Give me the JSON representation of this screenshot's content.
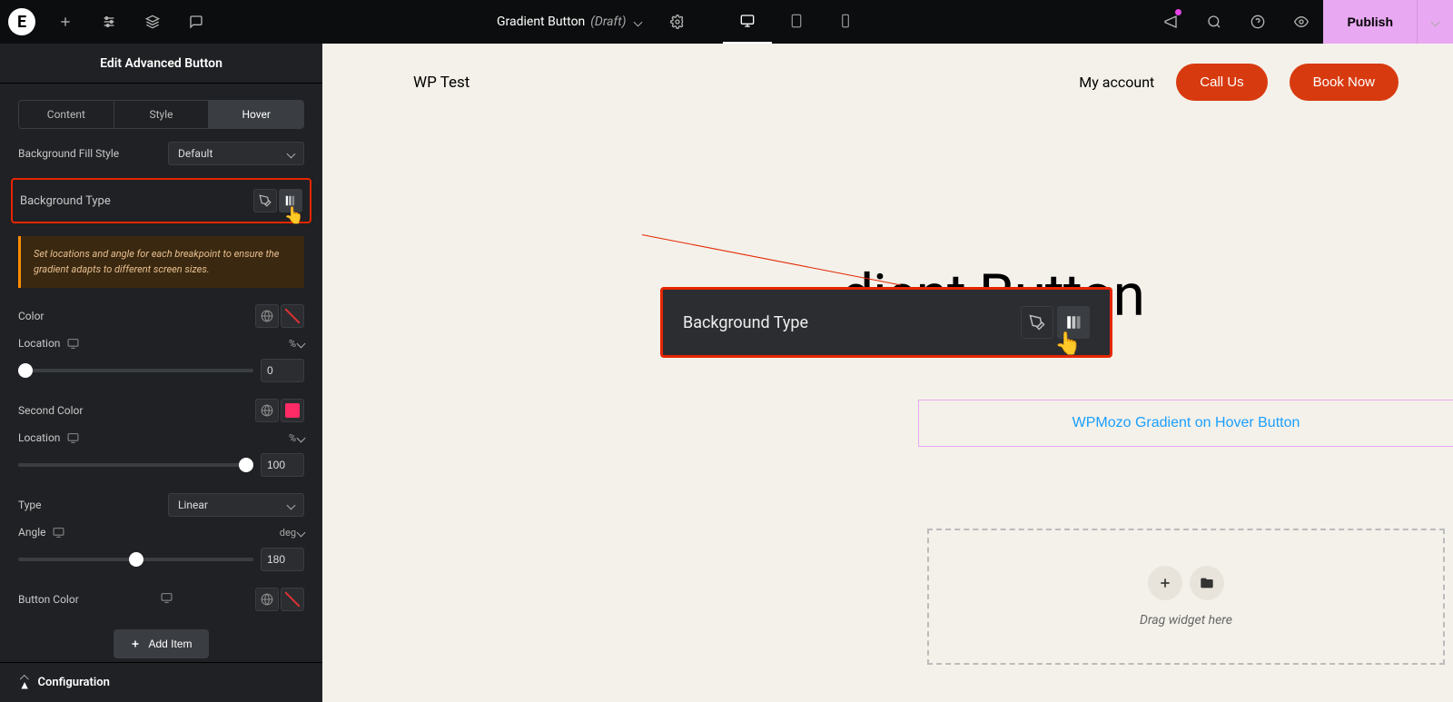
{
  "topbar": {
    "title": "Gradient Button",
    "draft": "(Draft)",
    "publish": "Publish"
  },
  "panel": {
    "title": "Edit Advanced Button",
    "tabs": {
      "content": "Content",
      "style": "Style",
      "hover": "Hover"
    },
    "bg_fill_style_label": "Background Fill Style",
    "bg_fill_style_value": "Default",
    "bg_type_label": "Background Type",
    "hint": "Set locations and angle for each breakpoint to ensure the gradient adapts to different screen sizes.",
    "color_label": "Color",
    "location_label": "Location",
    "location_unit": "%",
    "location1_value": "0",
    "second_color_label": "Second Color",
    "location2_value": "100",
    "type_label": "Type",
    "type_value": "Linear",
    "angle_label": "Angle",
    "angle_unit": "deg",
    "angle_value": "180",
    "button_color_label": "Button Color",
    "add_item": "Add Item",
    "configuration": "Configuration",
    "second_color_hex": "#ff2b66"
  },
  "callout": {
    "label": "Background Type"
  },
  "site": {
    "name": "WP Test",
    "nav_account": "My account",
    "cta1": "Call Us",
    "cta2": "Book Now",
    "hero": "dient Button",
    "demo_button": "WPMozo Gradient on Hover Button",
    "drop_text": "Drag widget here"
  }
}
